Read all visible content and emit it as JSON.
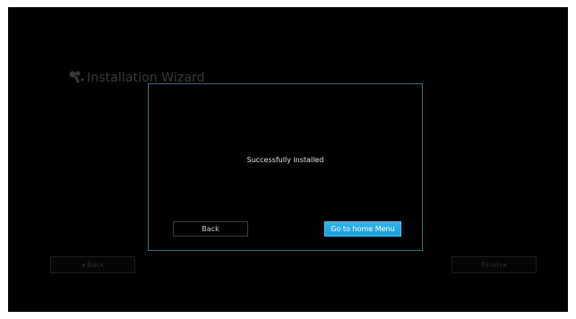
{
  "background": {
    "wizard_title": "Installation Wizard",
    "wizard_icon": "tools-icon",
    "back_button": "◂ Back",
    "finish_button": "Finish ▸"
  },
  "dialog": {
    "message": "Successfully installed",
    "back_button": "Back",
    "home_button": "Go to home Menu"
  },
  "colors": {
    "screen_background": "#000000",
    "dialog_border": "#3f6f7f",
    "primary_button": "#2fb4ec"
  }
}
